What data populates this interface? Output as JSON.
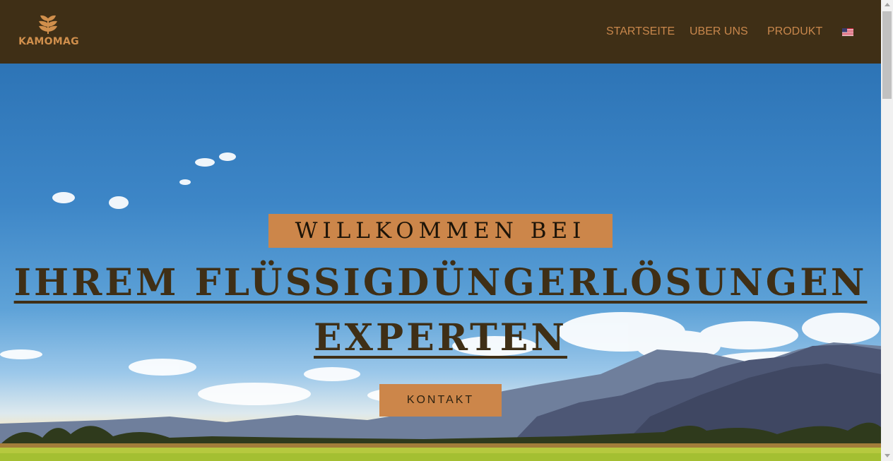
{
  "header": {
    "logo_text": "KAMOMAG",
    "nav": [
      {
        "label": "STARTSEITE"
      },
      {
        "label": "UBER UNS"
      },
      {
        "label": "PRODUKT"
      }
    ],
    "language_flag": "us-flag-icon"
  },
  "hero": {
    "welcome": "WILLKOMMEN BEI",
    "headline_line1": "IHREM FLÜSSIGDÜNGERLÖSUNGEN",
    "headline_line2": "EXPERTEN",
    "cta_label": "KONTAKT"
  },
  "colors": {
    "header_bg": "#3f2f16",
    "accent": "#cc864a",
    "heading": "#3f2f16"
  }
}
